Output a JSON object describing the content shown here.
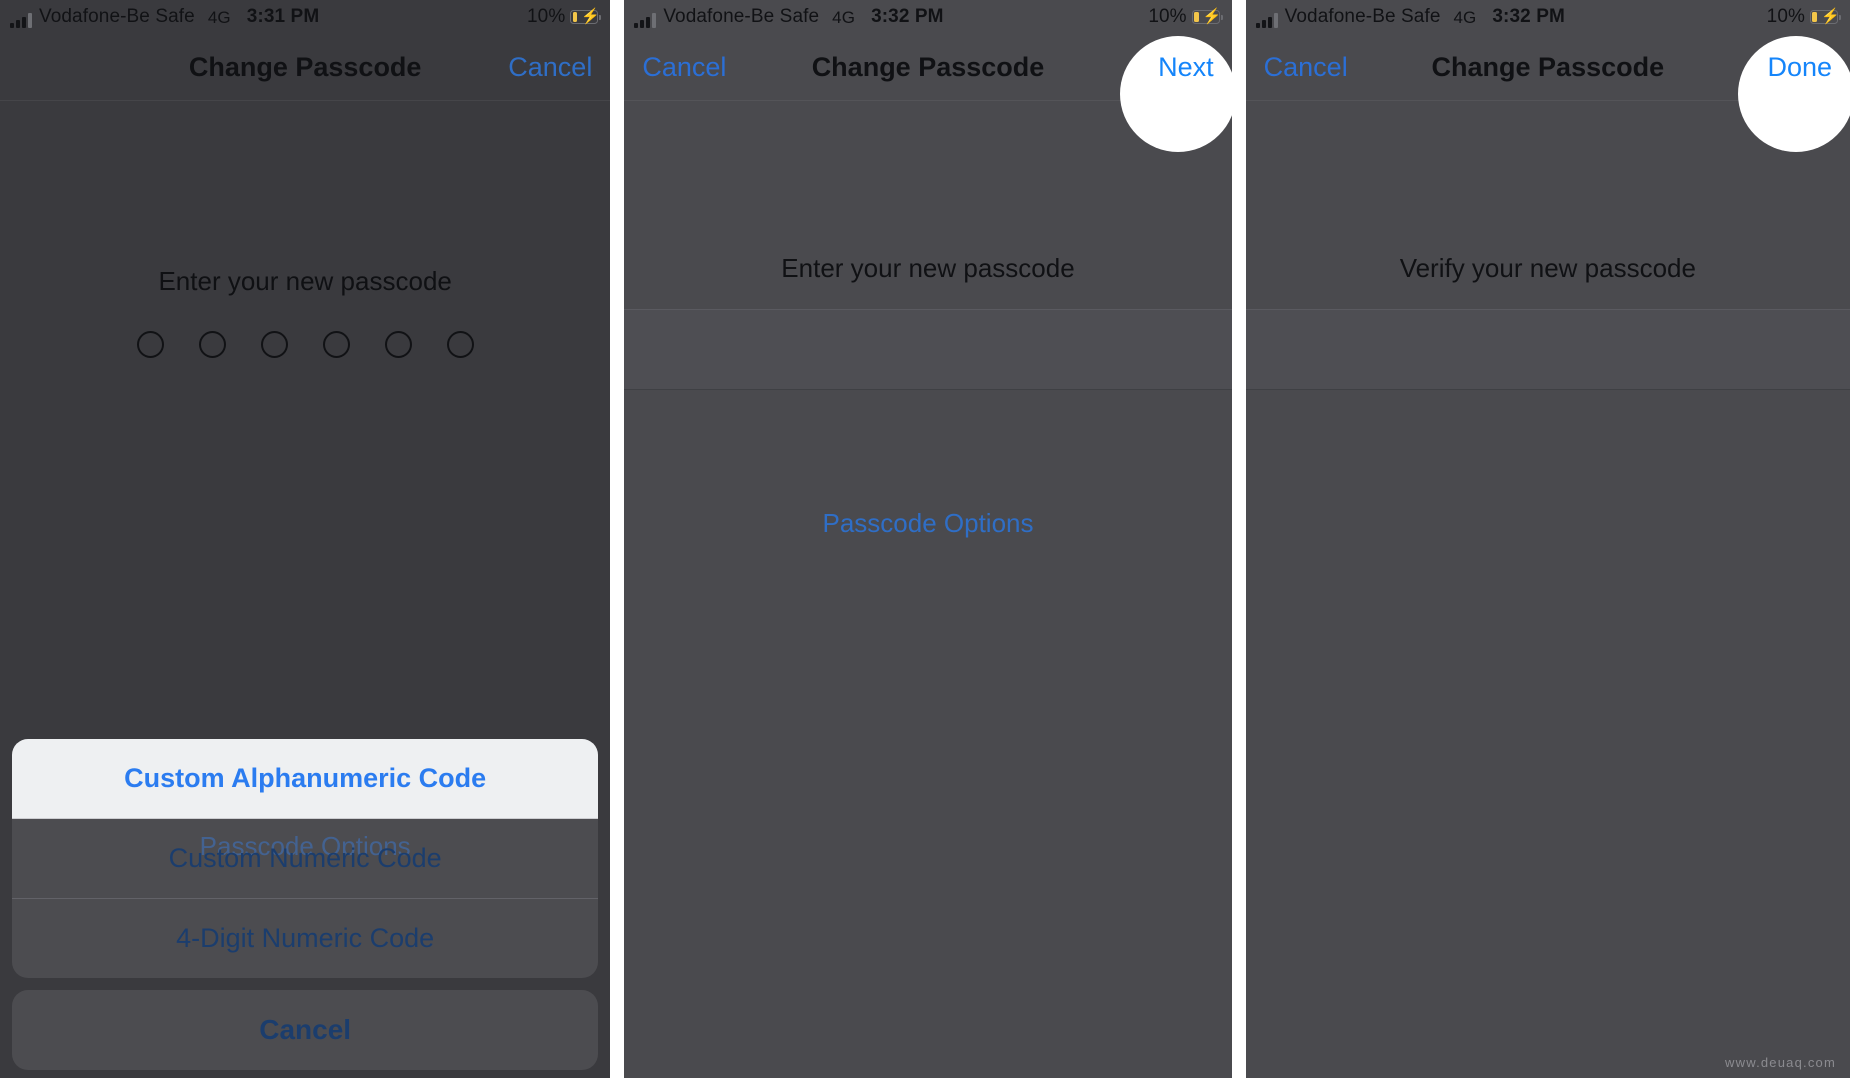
{
  "meta": {
    "watermark": "www.deuaq.com"
  },
  "colors": {
    "accent_blue": "#2b7cf0",
    "link_blue_dimmed": "#2f6ec6",
    "panel_bg": "#4a4a4e",
    "panel_bg_dimmed": "#3a3a3e",
    "highlight_white": "#eef0f2",
    "battery_yellow": "#f3c64a",
    "text_dark": "#101114"
  },
  "panels": [
    {
      "id": "panel-1",
      "status_bar": {
        "signal_icon": "signal-bars-icon",
        "carrier": "Vodafone-Be Safe",
        "network": "4G",
        "time": "3:31 PM",
        "battery_percent": "10%",
        "battery_icon": "battery-charging-icon",
        "charging_icon": "lightning-bolt-icon"
      },
      "nav": {
        "title": "Change Passcode",
        "left_button": "",
        "right_button": "Cancel",
        "highlighted_button": ""
      },
      "body": {
        "prompt": "Enter your new passcode",
        "dot_count": 6,
        "options_link": "Passcode Options",
        "has_textfield": false
      },
      "action_sheet": {
        "items": [
          {
            "label": "Custom Alphanumeric Code",
            "highlighted": true
          },
          {
            "label": "Custom Numeric Code",
            "highlighted": false
          },
          {
            "label": "4-Digit Numeric Code",
            "highlighted": false
          }
        ],
        "cancel": "Cancel"
      }
    },
    {
      "id": "panel-2",
      "status_bar": {
        "signal_icon": "signal-bars-icon",
        "carrier": "Vodafone-Be Safe",
        "network": "4G",
        "time": "3:32 PM",
        "battery_percent": "10%",
        "battery_icon": "battery-charging-icon",
        "charging_icon": "lightning-bolt-icon"
      },
      "nav": {
        "title": "Change Passcode",
        "left_button": "Cancel",
        "right_button": "Next",
        "highlighted_button": "Next"
      },
      "body": {
        "prompt": "Enter your new passcode",
        "dot_count": 0,
        "options_link": "Passcode Options",
        "has_textfield": true
      },
      "action_sheet": null
    },
    {
      "id": "panel-3",
      "status_bar": {
        "signal_icon": "signal-bars-icon",
        "carrier": "Vodafone-Be Safe",
        "network": "4G",
        "time": "3:32 PM",
        "battery_percent": "10%",
        "battery_icon": "battery-charging-icon",
        "charging_icon": "lightning-bolt-icon"
      },
      "nav": {
        "title": "Change Passcode",
        "left_button": "Cancel",
        "right_button": "Done",
        "highlighted_button": "Done"
      },
      "body": {
        "prompt": "Verify your new passcode",
        "dot_count": 0,
        "options_link": "",
        "has_textfield": true
      },
      "action_sheet": null
    }
  ]
}
